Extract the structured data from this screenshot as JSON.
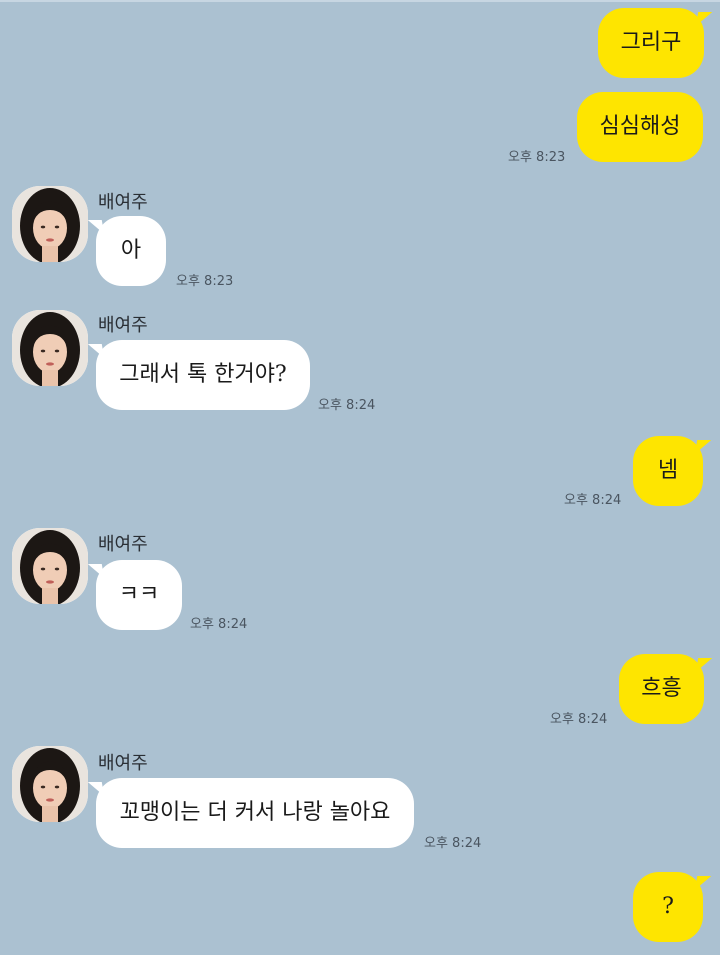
{
  "contact": {
    "name": "배여주"
  },
  "messages": [
    {
      "from": "me",
      "text": "그리구",
      "time": ""
    },
    {
      "from": "me",
      "text": "심심해성",
      "time": "오후 8:23"
    },
    {
      "from": "other",
      "text": "아",
      "time": "오후 8:23"
    },
    {
      "from": "other",
      "text": "그래서 톡 한거야?",
      "time": "오후 8:24"
    },
    {
      "from": "me",
      "text": "넴",
      "time": "오후 8:24"
    },
    {
      "from": "other",
      "text": "ㅋㅋ",
      "time": "오후 8:24"
    },
    {
      "from": "me",
      "text": "흐흥",
      "time": "오후 8:24"
    },
    {
      "from": "other",
      "text": "꼬맹이는 더 커서 나랑 놀아요",
      "time": "오후 8:24"
    },
    {
      "from": "me",
      "text": "?",
      "time": ""
    }
  ],
  "colors": {
    "background": "#abc1d1",
    "my_bubble": "#fee500",
    "their_bubble": "#ffffff"
  },
  "icons": {
    "avatar": "profile-photo-avatar"
  }
}
